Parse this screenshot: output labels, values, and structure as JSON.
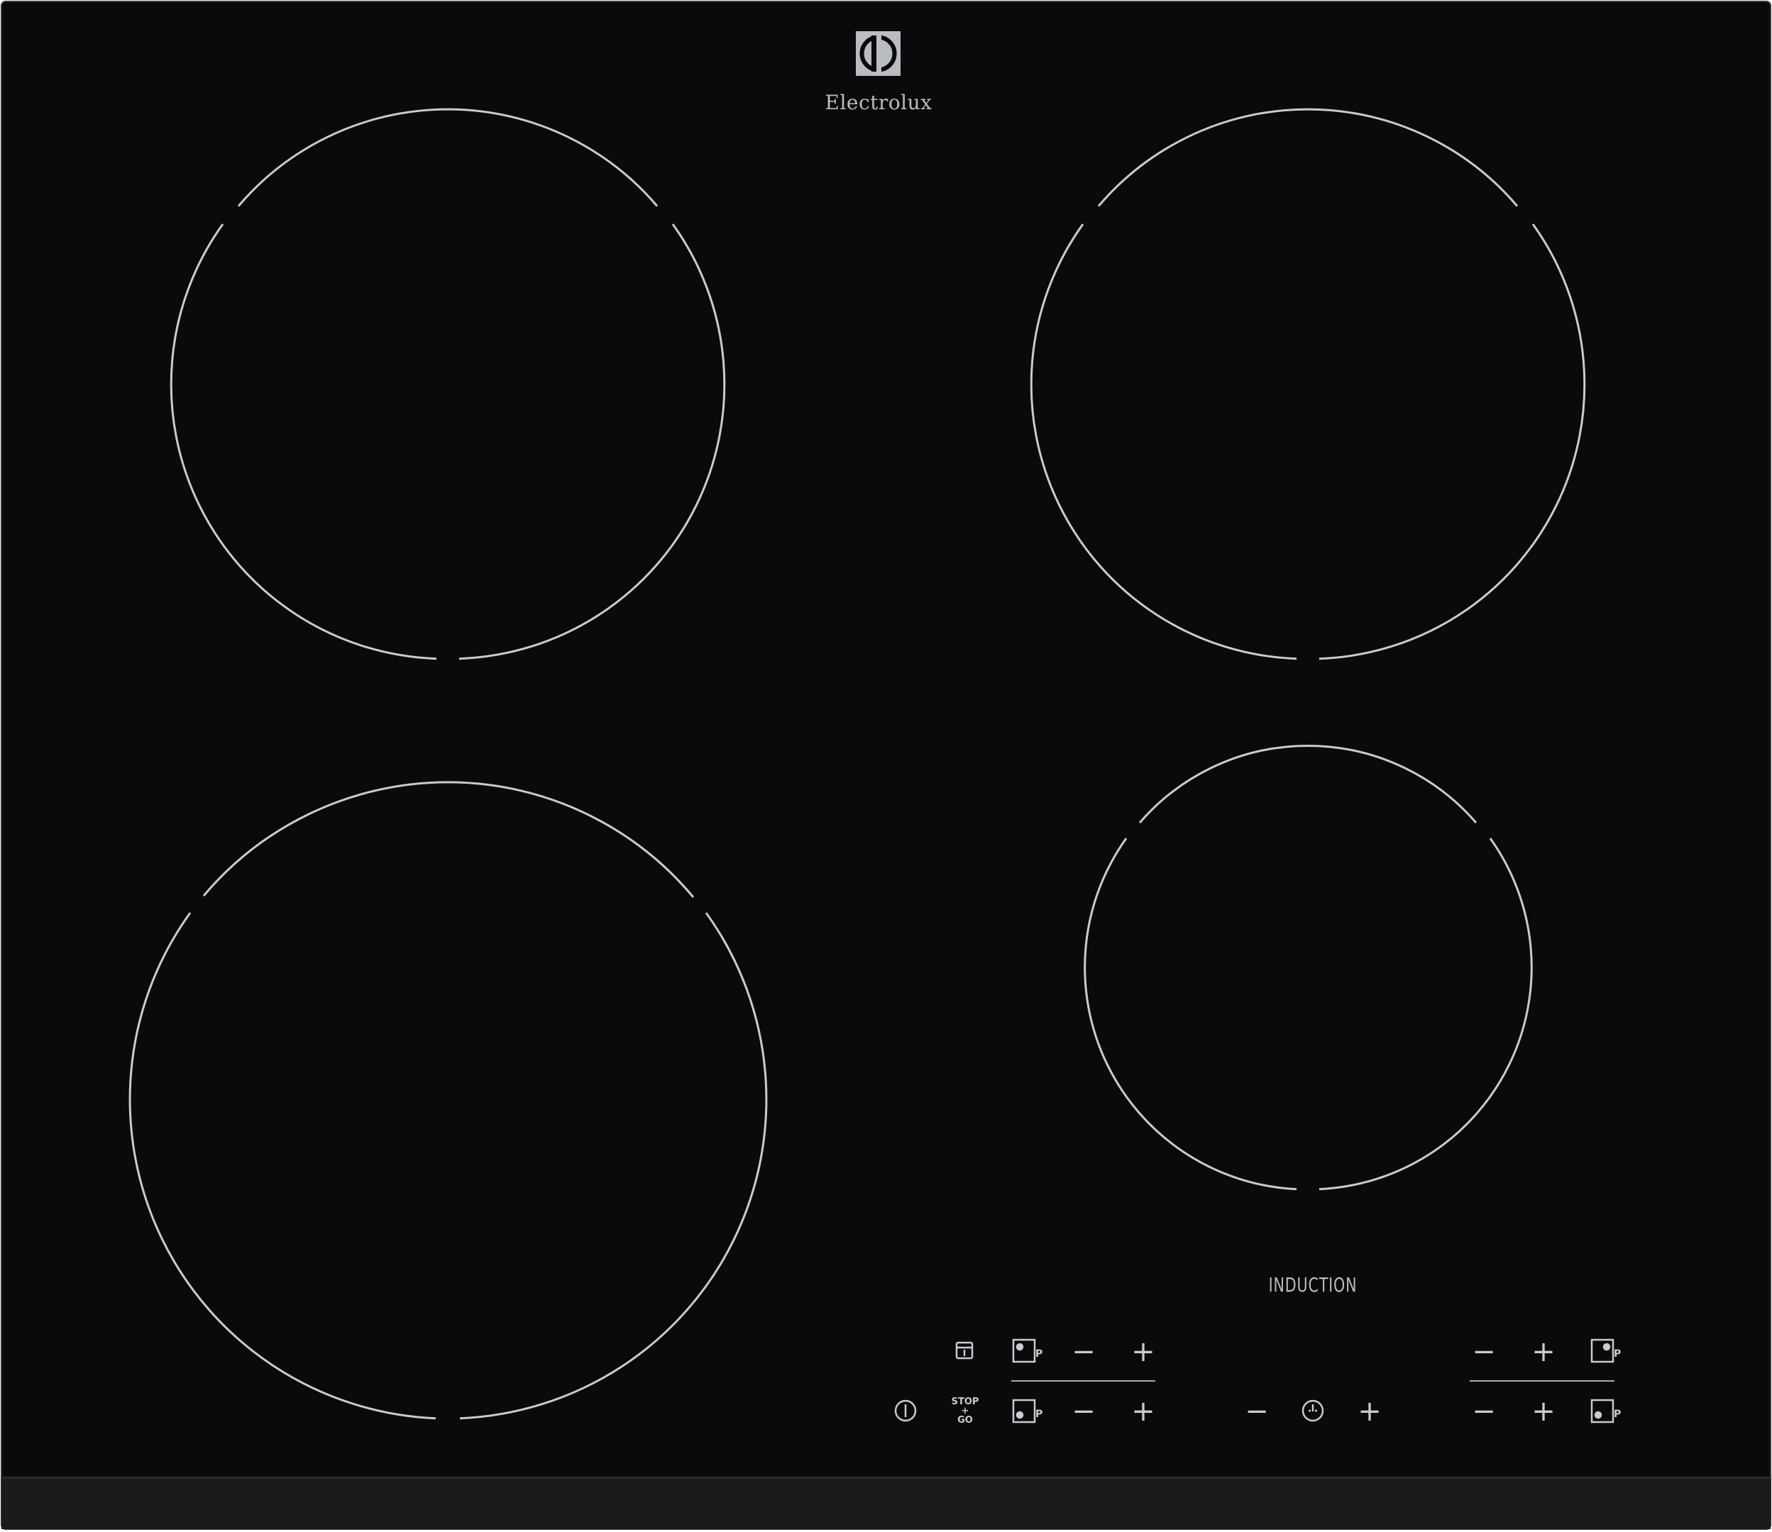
{
  "brand": {
    "name": "Electrolux",
    "logo": "electrolux-logo-icon"
  },
  "labels": {
    "induction": "INDUCTION"
  },
  "controls": {
    "left_top": {
      "icons": [
        "lock-icon",
        "pause-pot-icon"
      ],
      "minus": "−",
      "plus": "+"
    },
    "left_bottom": {
      "icons": [
        "power-icon",
        "pause-pot-icon"
      ],
      "stop_go": [
        "STOP",
        "+",
        "GO"
      ],
      "minus": "−",
      "plus": "+"
    },
    "timer": {
      "icon": "timer-icon",
      "minus": "−",
      "plus": "+"
    },
    "right_top": {
      "icon": "pause-pot-icon",
      "minus": "−",
      "plus": "+"
    },
    "right_bottom": {
      "icon": "pause-pot-icon",
      "minus": "−",
      "plus": "+"
    }
  },
  "colors": {
    "glass": "#0a0a0c",
    "markings": "#c8cbcf",
    "front_edge": "#1a1a1c"
  }
}
